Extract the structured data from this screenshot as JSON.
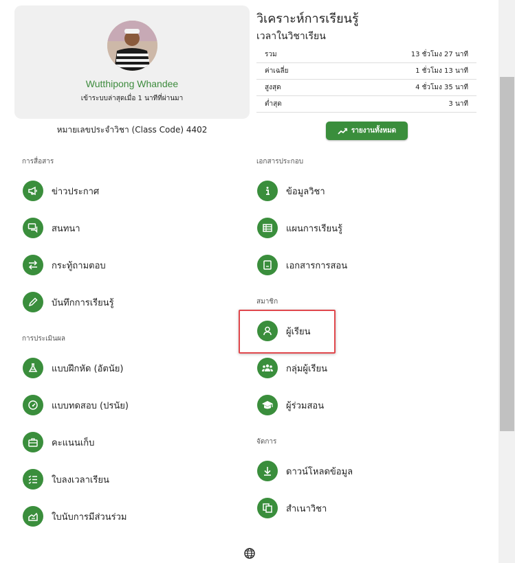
{
  "profile": {
    "name": "Wutthipong Whandee",
    "last_seen": "เข้าระบบล่าสุดเมื่อ 1 นาทีที่ผ่านมา",
    "class_code": "หมายเลขประจำวิชา (Class Code) 4402"
  },
  "analytics": {
    "title": "วิเคราะห์การเรียนรู้",
    "subtitle": "เวลาในวิชาเรียน",
    "rows": [
      {
        "label": "รวม",
        "value": "13 ชั่วโมง 27 นาที"
      },
      {
        "label": "ค่าเฉลี่ย",
        "value": "1 ชั่วโมง 13 นาที"
      },
      {
        "label": "สูงสุด",
        "value": "4 ชั่วโมง 35 นาที"
      },
      {
        "label": "ต่ำสุด",
        "value": "3 นาที"
      }
    ],
    "report_button": "รายงานทั้งหมด"
  },
  "left": {
    "communication_label": "การสื่อสาร",
    "communication": [
      {
        "label": "ข่าวประกาศ",
        "icon": "megaphone-icon"
      },
      {
        "label": "สนทนา",
        "icon": "chat-icon"
      },
      {
        "label": "กระทู้ถามตอบ",
        "icon": "swap-icon"
      },
      {
        "label": "บันทึกการเรียนรู้",
        "icon": "pencil-icon"
      }
    ],
    "assessment_label": "การประเมินผล",
    "assessment": [
      {
        "label": "แบบฝึกหัด (อัตนัย)",
        "icon": "flask-icon"
      },
      {
        "label": "แบบทดสอบ (ปรนัย)",
        "icon": "gauge-icon"
      },
      {
        "label": "คะแนนเก็บ",
        "icon": "briefcase-icon"
      },
      {
        "label": "ใบลงเวลาเรียน",
        "icon": "checklist-icon"
      },
      {
        "label": "ใบนับการมีส่วนร่วม",
        "icon": "hand-icon"
      }
    ]
  },
  "right": {
    "documents_label": "เอกสารประกอบ",
    "documents": [
      {
        "label": "ข้อมูลวิชา",
        "icon": "info-icon"
      },
      {
        "label": "แผนการเรียนรู้",
        "icon": "table-icon"
      },
      {
        "label": "เอกสารการสอน",
        "icon": "book-icon"
      }
    ],
    "members_label": "สมาชิก",
    "members": [
      {
        "label": "ผู้เรียน",
        "icon": "person-icon"
      },
      {
        "label": "กลุ่มผู้เรียน",
        "icon": "group-icon"
      },
      {
        "label": "ผู้ร่วมสอน",
        "icon": "graduation-cap-icon"
      }
    ],
    "manage_label": "จัดการ",
    "manage": [
      {
        "label": "ดาวน์โหลดข้อมูล",
        "icon": "download-icon"
      },
      {
        "label": "สำเนาวิชา",
        "icon": "copy-icon"
      }
    ]
  },
  "colors": {
    "accent": "#3a8e3c",
    "highlight": "#e0474c",
    "name": "#3d8b3d"
  }
}
